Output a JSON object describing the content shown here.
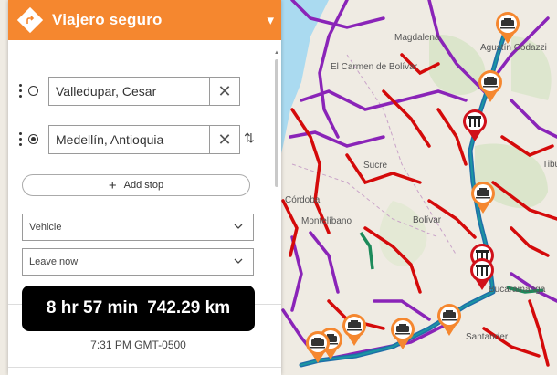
{
  "header": {
    "title": "Viajero seguro"
  },
  "stops": [
    {
      "value": "Valledupar, Cesar",
      "selected": false
    },
    {
      "value": "Medellín, Antioquia",
      "selected": true
    }
  ],
  "add_stop_label": "Add stop",
  "vehicle_select": {
    "value": "Vehicle"
  },
  "time_select": {
    "value": "Leave now"
  },
  "summary": {
    "duration": "8 hr 57 min",
    "distance": "742.29 km"
  },
  "arrival": "7:31 PM GMT-0500",
  "map": {
    "place_labels": [
      "Magdalena",
      "Agustín Codazzi",
      "El Carmen de Bolívar",
      "Sucre",
      "Córdoba",
      "Montelíbano",
      "Bolívar",
      "Bucaramanga",
      "Santander",
      "Tibú"
    ],
    "colors": {
      "congestion": "#d00000",
      "alt_route": "#7b1fa2",
      "route": "#1e6fa8",
      "accent": "#f5872f"
    }
  }
}
